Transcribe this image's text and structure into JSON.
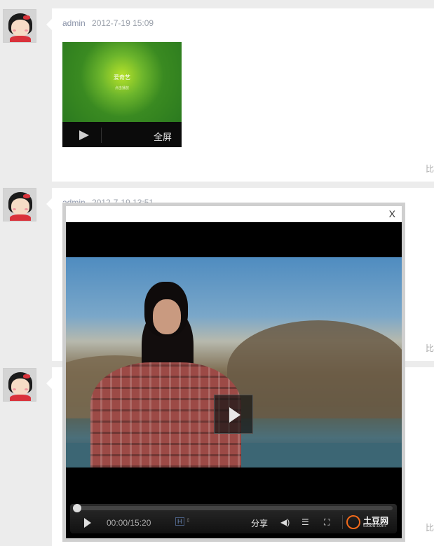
{
  "posts": [
    {
      "author": "admin",
      "date": "2012-7-19 15:09",
      "side_char": "比"
    },
    {
      "author": "admin",
      "date": "2012-7-19 13:51",
      "side_char": "比"
    },
    {
      "author": "",
      "date": "",
      "side_char": "比"
    }
  ],
  "thumbnail": {
    "brand_text": "爱奇艺",
    "brand_sub": "点击播放",
    "fullscreen_label": "全屏"
  },
  "popup": {
    "close_label": "X",
    "player": {
      "time": "00:00/15:20",
      "hd_label": "H",
      "share_label": "分享",
      "brand_name": "土豆网",
      "brand_domain": "tudou.com"
    }
  },
  "colors": {
    "page_bg": "#ececec",
    "card_bg": "#ffffff",
    "meta_text": "#9aa0aa",
    "tudou_orange": "#f26a1b"
  }
}
